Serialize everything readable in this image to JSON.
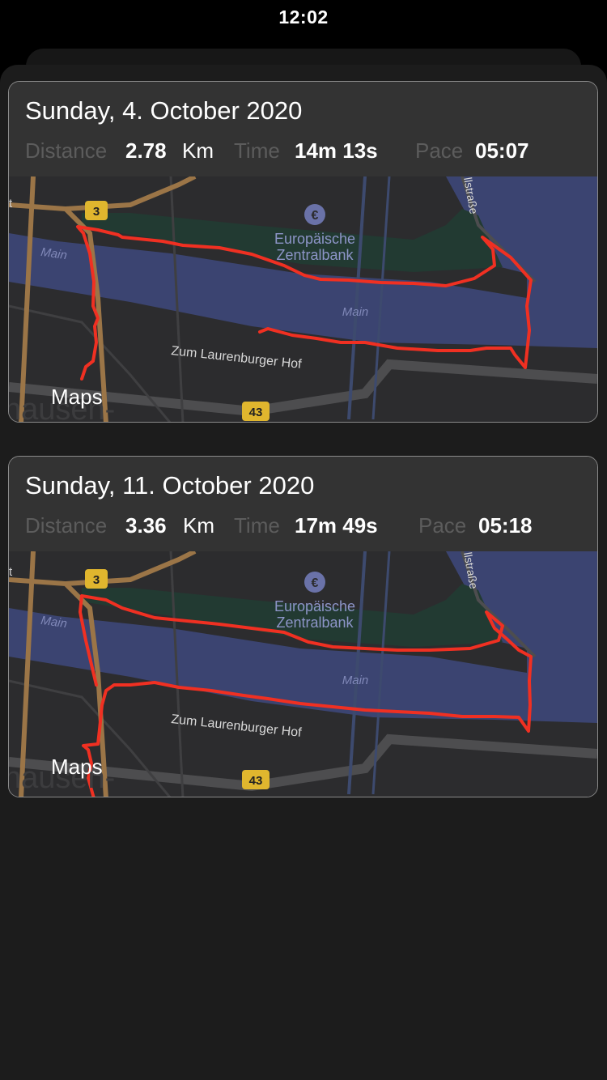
{
  "status_bar": {
    "time": "12:02"
  },
  "colors": {
    "route": "#f03022",
    "river": "#3b4471",
    "land": "#2c2c2e",
    "road_major": "#9b7547",
    "sheet": "#1c1c1c"
  },
  "runs": [
    {
      "date": "Sunday, 4. October 2020",
      "distance_label": "Distance",
      "distance_value": "2.78",
      "distance_unit": "Km",
      "time_label": "Time",
      "time_value": "14m 13s",
      "pace_label": "Pace",
      "pace_value": "05:07",
      "map": {
        "poi_name_line1": "Europäische",
        "poi_name_line2": "Zentralbank",
        "poi_icon": "euro-bank-icon",
        "river_label": "Main",
        "river_label_2": "Main",
        "street_label": "Zum Laurenburger Hof",
        "street_label_2": "llstraße",
        "route_shield_1": "3",
        "route_shield_2": "43",
        "place_fragment_left": "t",
        "place_fragment_bottom": "hausen-",
        "attribution": "Maps",
        "attribution_icon": "apple-logo-icon"
      }
    },
    {
      "date": "Sunday, 11. October 2020",
      "distance_label": "Distance",
      "distance_value": "3.36",
      "distance_unit": "Km",
      "time_label": "Time",
      "time_value": "17m 49s",
      "pace_label": "Pace",
      "pace_value": "05:18",
      "map": {
        "poi_name_line1": "Europäische",
        "poi_name_line2": "Zentralbank",
        "poi_icon": "euro-bank-icon",
        "river_label": "Main",
        "river_label_2": "Main",
        "street_label": "Zum Laurenburger Hof",
        "street_label_2": "llstraße",
        "route_shield_1": "3",
        "route_shield_2": "43",
        "place_fragment_left": "t",
        "place_fragment_bottom": "hausen-",
        "attribution": "Maps",
        "attribution_icon": "apple-logo-icon"
      }
    }
  ]
}
